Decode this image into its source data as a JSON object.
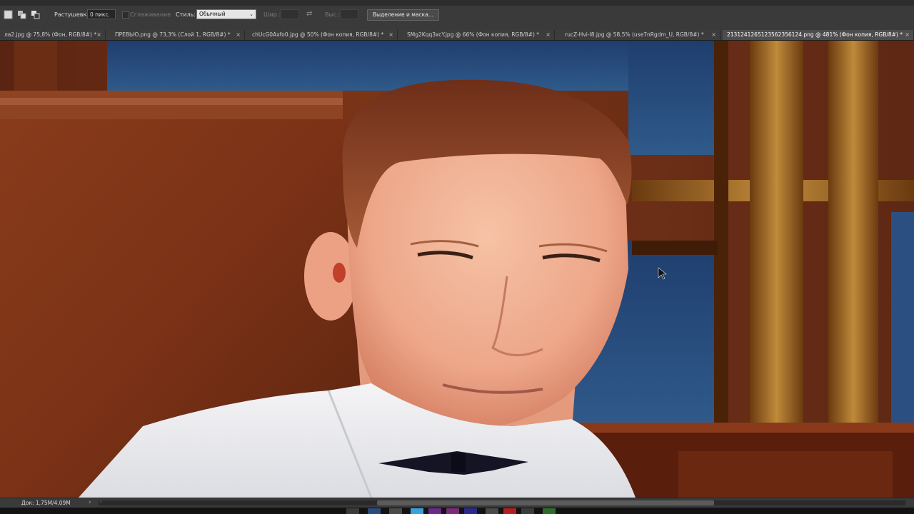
{
  "options_bar": {
    "feather_label": "Растушевка:",
    "feather_value": "0 пикс.",
    "antialias_label": "Сглаживание",
    "style_label": "Стиль:",
    "style_value": "Обычный",
    "width_label": "Шир.:",
    "height_label": "Выс.:",
    "select_mask_button": "Выделение и маска..."
  },
  "tabs": [
    {
      "label": "ла2.jpg @ 75,8% (Фон, RGB/8#) *",
      "active": false
    },
    {
      "label": "ПРЕВЬЮ.png @ 73,3% (Слой 1, RGB/8#) *",
      "active": false
    },
    {
      "label": "chUcG0Axfo0.jpg @ 50% (Фон копия, RGB/8#) *",
      "active": false
    },
    {
      "label": "SMg2Kqq3xcY.jpg @ 66% (Фон копия, RGB/8#) *",
      "active": false
    },
    {
      "label": "rucZ-Hvi-I8.jpg @ 58,5% (use7nRgdm_U, RGB/8#) *",
      "active": false
    },
    {
      "label": "2131241265123562356124.png @ 481% (Фон копия, RGB/8#) *",
      "active": true
    }
  ],
  "tab_close": "×",
  "status_bar": {
    "doc_size": "Док: 1,75M/4,09M"
  },
  "icons": {
    "new_selection": "square-icon",
    "add_selection": "add-selection-icon",
    "subtract_selection": "subtract-selection-icon",
    "swap": "swap-arrows-icon",
    "cursor": "arrow-cursor-icon"
  }
}
